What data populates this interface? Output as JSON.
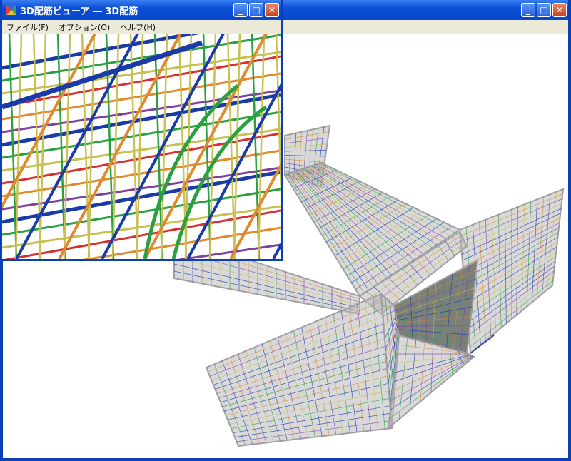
{
  "outer_window": {
    "buttons": {
      "minimize": "_",
      "maximize": "□",
      "close": "✕"
    }
  },
  "viewer_window": {
    "title": "3D配筋ビューア ― 3D配筋",
    "menu": [
      {
        "label": "ファイル(F)"
      },
      {
        "label": "オプション(O)"
      },
      {
        "label": "ヘルプ(H)"
      }
    ],
    "buttons": {
      "minimize": "_",
      "maximize": "□",
      "close": "✕"
    }
  },
  "colors": {
    "titlebar": "#0a4fd8",
    "concrete": "#b9b9bc",
    "rebar_blue": "#1a3aa8",
    "rebar_green": "#2aa040",
    "rebar_yellow": "#c8c050",
    "rebar_red": "#d83030",
    "rebar_orange": "#e08a30",
    "rebar_purple": "#8040a0"
  }
}
